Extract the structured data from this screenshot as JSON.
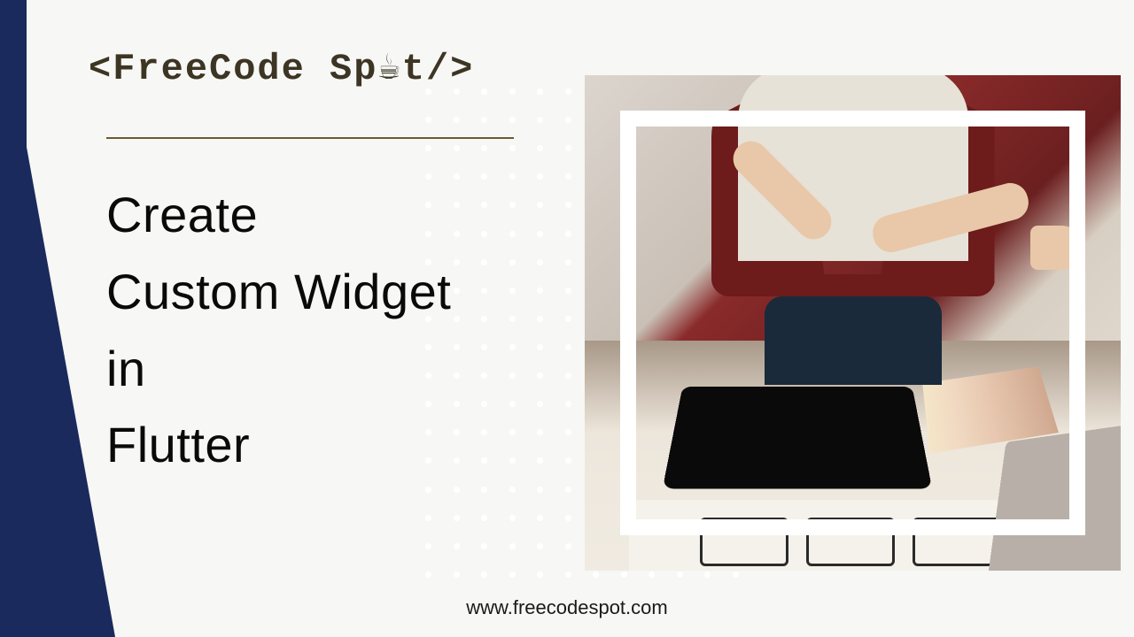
{
  "logo": {
    "text_open": "<FreeCode Sp",
    "text_close": "t/>"
  },
  "title": {
    "line1": "Create",
    "line2": "Custom Widget",
    "line3": "in",
    "line4": "Flutter"
  },
  "footer": {
    "url": "www.freecodespot.com"
  },
  "colors": {
    "navy": "#1a2a5c",
    "olive": "#6b5a2e",
    "cardigan": "#6d1b1b"
  }
}
